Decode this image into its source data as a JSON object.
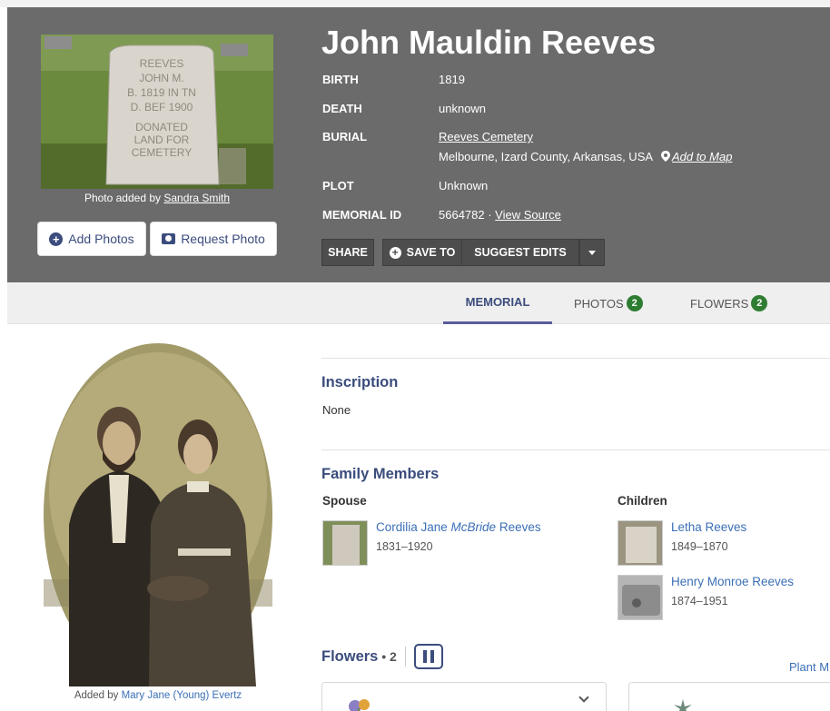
{
  "header": {
    "name": "John Mauldin Reeves",
    "rows": [
      {
        "label": "BIRTH",
        "value": "1819"
      },
      {
        "label": "DEATH",
        "value": "unknown"
      },
      {
        "label": "BURIAL",
        "value": "Reeves Cemetery",
        "location": "Melbourne, Izard County, Arkansas, USA",
        "map_link": "Add to Map"
      },
      {
        "label": "PLOT",
        "value": "Unknown"
      },
      {
        "label": "MEMORIAL ID",
        "value": "5664782 · ",
        "source_link": "View Source"
      }
    ],
    "photo_caption_prefix": "Photo added by ",
    "photo_caption_user": "Sandra Smith",
    "headstone_text": [
      "REEVES",
      "JOHN M.",
      "B. 1819 IN TN",
      "D. BEF 1900",
      "DONATED",
      "LAND FOR",
      "CEMETERY"
    ],
    "add_photos_label": "Add Photos",
    "request_photo_label": "Request Photo",
    "actions": {
      "share": "SHARE",
      "save_to": "SAVE TO",
      "suggest_edits": "SUGGEST EDITS"
    }
  },
  "tabs": [
    {
      "label": "MEMORIAL",
      "active": true
    },
    {
      "label": "PHOTOS",
      "count": "2"
    },
    {
      "label": "FLOWERS",
      "count": "2"
    }
  ],
  "portrait": {
    "caption_prefix": "Added by ",
    "caption_user": "Mary Jane (Young) Evertz"
  },
  "inscription": {
    "title": "Inscription",
    "value": "None"
  },
  "family": {
    "title": "Family Members",
    "spouse_heading": "Spouse",
    "children_heading": "Children",
    "spouse": {
      "first": "Cordilia Jane ",
      "maiden": "McBride",
      "last": " Reeves",
      "dates": "1831–1920"
    },
    "children": [
      {
        "name": "Letha Reeves",
        "dates": "1849–1870"
      },
      {
        "name": "Henry Monroe Reeves",
        "dates": "1874–1951"
      }
    ]
  },
  "flowers": {
    "title": "Flowers",
    "count_text": " • 2",
    "plant_link": "Plant M"
  },
  "colors": {
    "header_bg": "#6b6b6b",
    "accent": "#3b4c7d",
    "link": "#3b6fb6",
    "badge": "#2e7d32"
  }
}
